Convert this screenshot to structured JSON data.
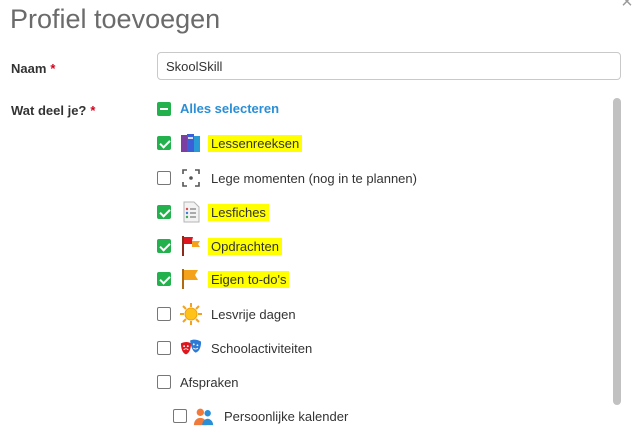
{
  "dialog": {
    "title": "Profiel toevoegen",
    "close_glyph": "×"
  },
  "form": {
    "name_label": "Naam",
    "required_mark": "*",
    "name_value": "SkoolSkill",
    "share_label": "Wat deel je?",
    "select_all": {
      "label": "Alles selecteren",
      "state": "indeterminate"
    }
  },
  "items": [
    {
      "label": "Lessenreeksen",
      "checked": true,
      "icon": "book-stack-icon",
      "highlighted": true
    },
    {
      "label": "Lege momenten (nog in te plannen)",
      "checked": false,
      "icon": "empty-slot-icon",
      "highlighted": false
    },
    {
      "label": "Lesfiches",
      "checked": true,
      "icon": "document-list-icon",
      "highlighted": true
    },
    {
      "label": "Opdrachten",
      "checked": true,
      "icon": "red-flag-icon",
      "highlighted": true
    },
    {
      "label": "Eigen to-do's",
      "checked": true,
      "icon": "orange-flag-icon",
      "highlighted": true
    },
    {
      "label": "Lesvrije dagen",
      "checked": false,
      "icon": "sun-icon",
      "highlighted": false
    },
    {
      "label": "Schoolactiviteiten",
      "checked": false,
      "icon": "theater-masks-icon",
      "highlighted": false
    },
    {
      "label": "Afspraken",
      "checked": false,
      "icon": "",
      "highlighted": false
    },
    {
      "label": "Persoonlijke kalender",
      "checked": false,
      "icon": "people-icon",
      "highlighted": false
    }
  ],
  "colors": {
    "check_green": "#22b14c",
    "link_blue": "#2a8fd6",
    "highlight": "#ffff00",
    "required_red": "#d0021b"
  }
}
